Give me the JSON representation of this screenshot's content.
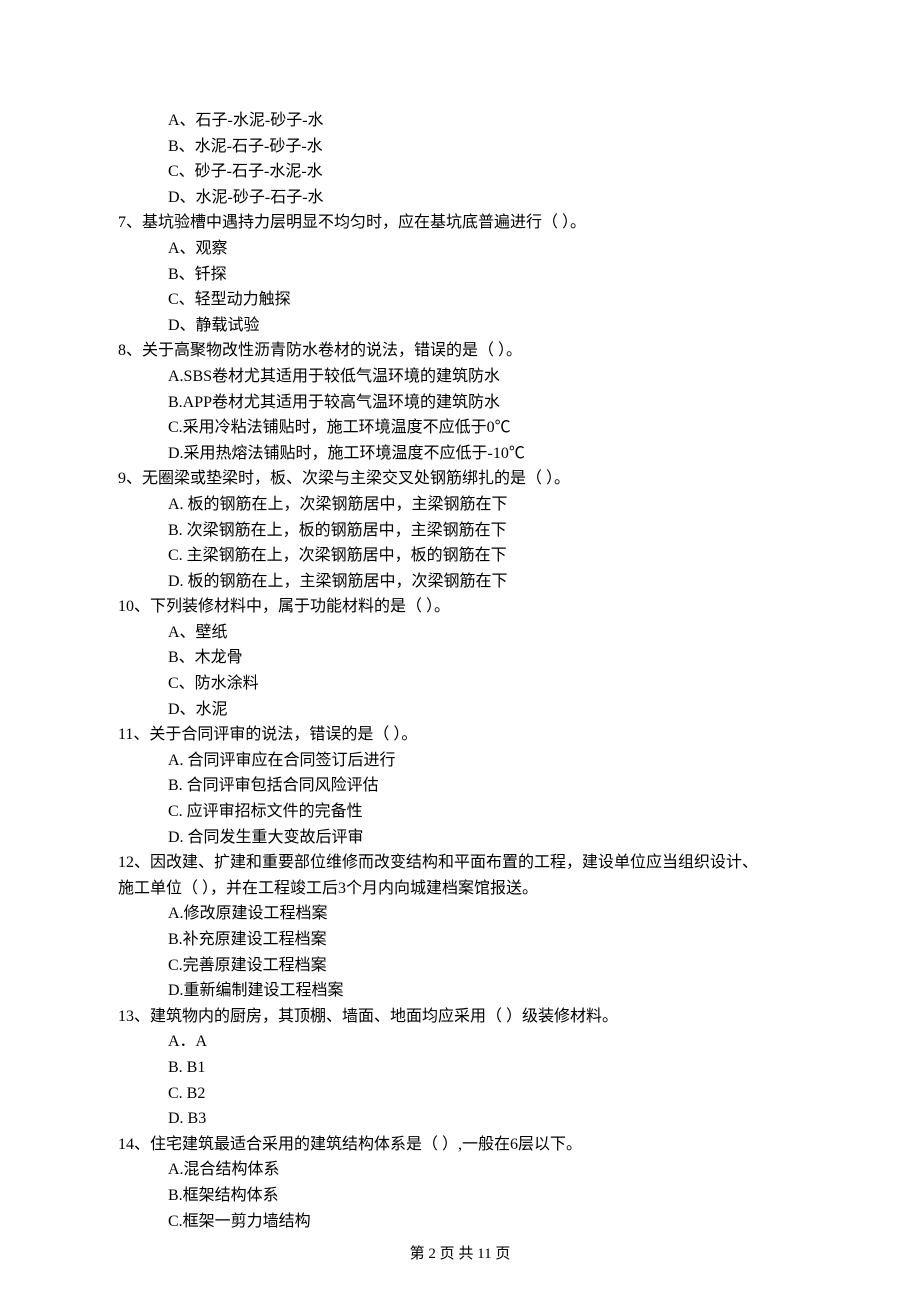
{
  "q6_pre": {
    "a": "A、石子-水泥-砂子-水",
    "b": "B、水泥-石子-砂子-水",
    "c": "C、砂子-石子-水泥-水",
    "d": "D、水泥-砂子-石子-水"
  },
  "q7": {
    "stem": "7、基坑验槽中遇持力层明显不均匀时，应在基坑底普遍进行（     ）。",
    "a": "A、观察",
    "b": "B、钎探",
    "c": "C、轻型动力触探",
    "d": "D、静载试验"
  },
  "q8": {
    "stem": "8、关于高聚物改性沥青防水卷材的说法，错误的是（    ）。",
    "a": "A.SBS卷材尤其适用于较低气温环境的建筑防水",
    "b": "B.APP卷材尤其适用于较高气温环境的建筑防水",
    "c": "C.采用冷粘法铺贴时，施工环境温度不应低于0℃",
    "d": "D.采用热熔法铺贴时，施工环境温度不应低于-10℃"
  },
  "q9": {
    "stem": "9、无圈梁或垫梁时，板、次梁与主梁交叉处钢筋绑扎的是（    ）。",
    "a": "A. 板的钢筋在上，次梁钢筋居中，主梁钢筋在下",
    "b": "B. 次梁钢筋在上，板的钢筋居中，主梁钢筋在下",
    "c": "C. 主梁钢筋在上，次梁钢筋居中，板的钢筋在下",
    "d": "D. 板的钢筋在上，主梁钢筋居中，次梁钢筋在下"
  },
  "q10": {
    "stem": "10、下列装修材料中，属于功能材料的是（     ）。",
    "a": "A、壁纸",
    "b": "B、木龙骨",
    "c": "C、防水涂料",
    "d": "D、水泥"
  },
  "q11": {
    "stem": "11、关于合同评审的说法，错误的是（    ）。",
    "a": "A. 合同评审应在合同签订后进行",
    "b": "B. 合同评审包括合同风险评估",
    "c": "C. 应评审招标文件的完备性",
    "d": "D. 合同发生重大变故后评审"
  },
  "q12": {
    "stem1": "12、因改建、扩建和重要部位维修而改变结构和平面布置的工程，建设单位应当组织设计、",
    "stem2": "施工单位（    ），并在工程竣工后3个月内向城建档案馆报送。",
    "a": "A.修改原建设工程档案",
    "b": "B.补充原建设工程档案",
    "c": "C.完善原建设工程档案",
    "d": "D.重新编制建设工程档案"
  },
  "q13": {
    "stem": "13、建筑物内的厨房，其顶棚、墙面、地面均应采用（    ）级装修材料。",
    "a": "A．A",
    "b": "B. B1",
    "c": "C. B2",
    "d": "D. B3"
  },
  "q14": {
    "stem": "14、住宅建筑最适合采用的建筑结构体系是（    ）,一般在6层以下。",
    "a": "A.混合结构体系",
    "b": "B.框架结构体系",
    "c": "C.框架一剪力墙结构"
  },
  "footer": "第 2 页 共 11 页"
}
